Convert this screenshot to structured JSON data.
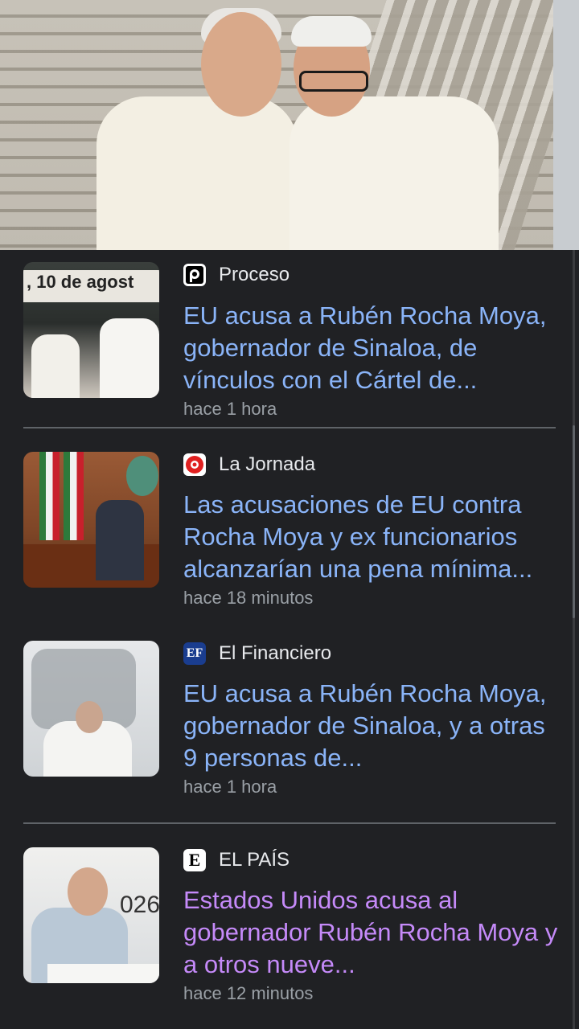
{
  "articles": [
    {
      "source": "Proceso",
      "headline": "EU acusa a Rubén Rocha Moya, gobernador de Sinaloa, de vínculos con el Cártel de...",
      "time": "hace 1 hora",
      "thumb_text": ", 10 de agost"
    },
    {
      "source": "La Jornada",
      "headline": "Las acusaciones de EU contra Rocha Moya y ex funcionarios alcanzarían una pena mínima...",
      "time": "hace 18 minutos"
    },
    {
      "source": "El Financiero",
      "headline": "EU acusa a Rubén Rocha Moya, gobernador de Sinaloa, y a otras 9 personas de...",
      "time": "hace 1 hora",
      "logo_text": "EF"
    },
    {
      "source": "EL PAÍS",
      "headline": "Estados Unidos acusa al gobernador Rubén Rocha Moya y a otros nueve...",
      "time": "hace 12 minutos",
      "logo_text": "E",
      "thumb_text": "026"
    }
  ],
  "colors": {
    "background": "#202124",
    "link": "#8ab4f8",
    "visited_link": "#c58af9",
    "meta_text": "#9aa0a6"
  }
}
